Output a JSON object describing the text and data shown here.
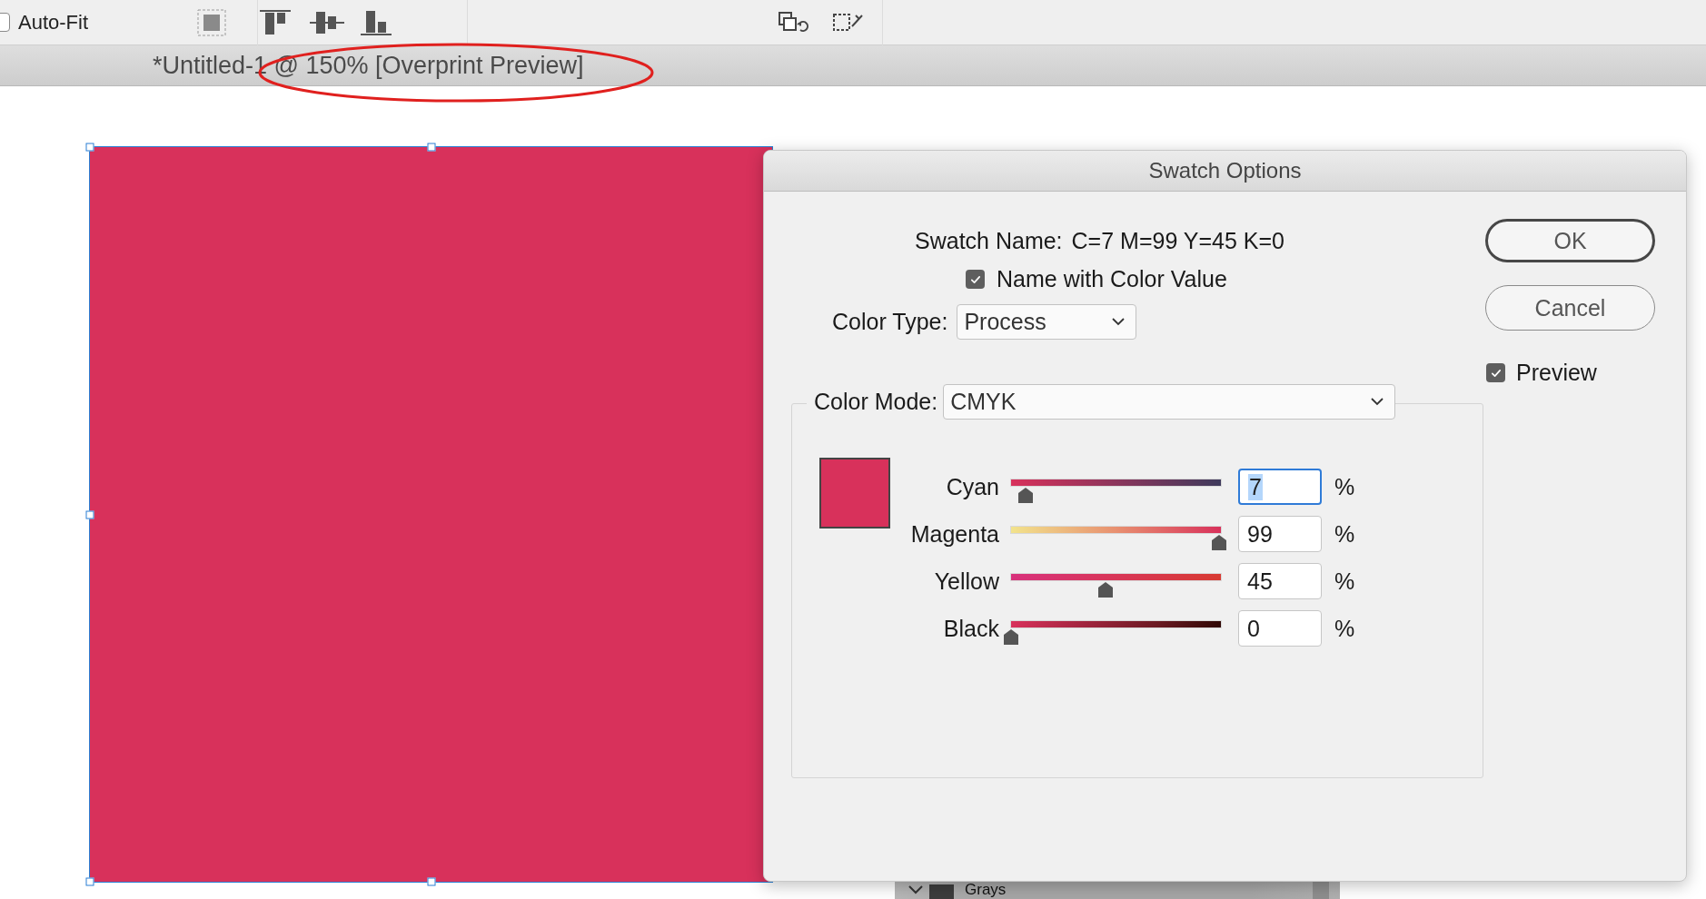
{
  "toolbar": {
    "auto_fit": {
      "label": "Auto-Fit",
      "checked": false
    }
  },
  "document_tab": {
    "title": "*Untitled-1 @ 150% [Overprint Preview]"
  },
  "dialog": {
    "title": "Swatch Options",
    "swatch_name_label": "Swatch Name:",
    "swatch_name": "C=7 M=99 Y=45 K=0",
    "name_with_color_value": {
      "label": "Name with Color Value",
      "checked": true
    },
    "color_type": {
      "label": "Color Type:",
      "value": "Process"
    },
    "color_mode": {
      "label": "Color Mode:",
      "value": "CMYK"
    },
    "channels": [
      {
        "name": "Cyan",
        "level": 0.07,
        "value": "7",
        "unit": "%",
        "focused": true
      },
      {
        "name": "Magenta",
        "level": 0.99,
        "value": "99",
        "unit": "%",
        "focused": false
      },
      {
        "name": "Yellow",
        "level": 0.45,
        "value": "45",
        "unit": "%",
        "focused": false
      },
      {
        "name": "Black",
        "level": 0,
        "value": "0",
        "unit": "%",
        "focused": false
      }
    ],
    "buttons": [
      {
        "label": "OK",
        "kind": "default"
      },
      {
        "label": "Cancel",
        "kind": "normal"
      }
    ],
    "preview": {
      "label": "Preview",
      "checked": true
    }
  },
  "swatches_panel": {
    "group": {
      "name": "Grays",
      "expanded": true
    }
  }
}
